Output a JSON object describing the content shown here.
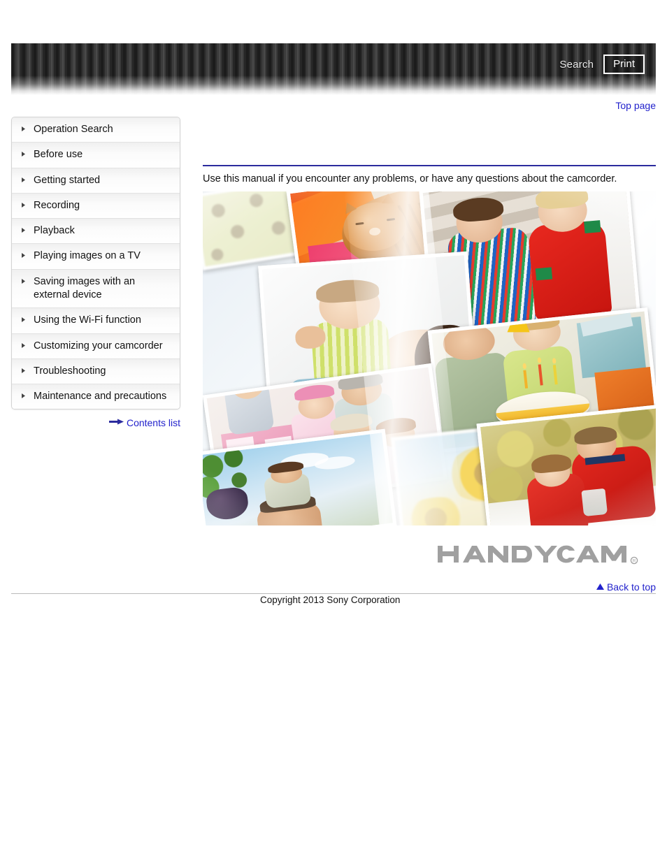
{
  "header": {
    "search_label": "Search",
    "print_label": "Print",
    "search_icon": "search-icon",
    "print_icon": "print-icon"
  },
  "top_nav": {
    "top_page_label": "Top page"
  },
  "sidebar": {
    "items": [
      {
        "label": "Operation Search"
      },
      {
        "label": "Before use"
      },
      {
        "label": "Getting started"
      },
      {
        "label": "Recording"
      },
      {
        "label": "Playback"
      },
      {
        "label": "Playing images on a TV"
      },
      {
        "label": "Saving images with an external device"
      },
      {
        "label": "Using the Wi-Fi function"
      },
      {
        "label": "Customizing your camcorder"
      },
      {
        "label": "Troubleshooting"
      },
      {
        "label": "Maintenance and precautions"
      }
    ],
    "contents_list_label": "Contents list",
    "contents_list_icon": "arrow-right-icon"
  },
  "main": {
    "intro_text": "Use this manual if you encounter any problems, or have any questions about the camcorder.",
    "collage_alt": "Photo collage of family moments: sleeping cat, baby with father, children in striped pajamas, birthday cake with candles, girl with dollhouse, father carrying child in vineyard, sunflowers, father and daughter outdoors",
    "photos": [
      {
        "name": "sunflower-field-photo",
        "caption": "Sunflower field"
      },
      {
        "name": "sleeping-cat-photo",
        "caption": "Ginger cat sleeping on colorful blankets"
      },
      {
        "name": "baby-and-father-photo",
        "caption": "Baby in green striped outfit with father"
      },
      {
        "name": "children-pajamas-photo",
        "caption": "Two children in striped and red pajamas on stairs"
      },
      {
        "name": "birthday-cake-photo",
        "caption": "Boy with party hat and birthday cake with candles"
      },
      {
        "name": "dollhouse-family-photo",
        "caption": "Girl in pink with family at dollhouse"
      },
      {
        "name": "vineyard-father-child-photo",
        "caption": "Father carrying child on shoulders in vineyard"
      },
      {
        "name": "sunflower-closeup-photo",
        "caption": "Close-up of sunflower against blue sky"
      },
      {
        "name": "outdoor-father-daughter-photo",
        "caption": "Father and daughter in red jackets outdoors"
      }
    ]
  },
  "branding": {
    "logo_text": "HANDYCAM",
    "logo_trademark": "®"
  },
  "footer": {
    "back_to_top_label": "Back to top",
    "back_to_top_icon": "triangle-up-icon",
    "copyright": "Copyright 2013 Sony Corporation"
  },
  "colors": {
    "link_blue": "#2222cc",
    "rule_navy": "#2b2b9e",
    "banner_dark": "#2a2a2a",
    "logo_gray": "#9a9a9a"
  }
}
